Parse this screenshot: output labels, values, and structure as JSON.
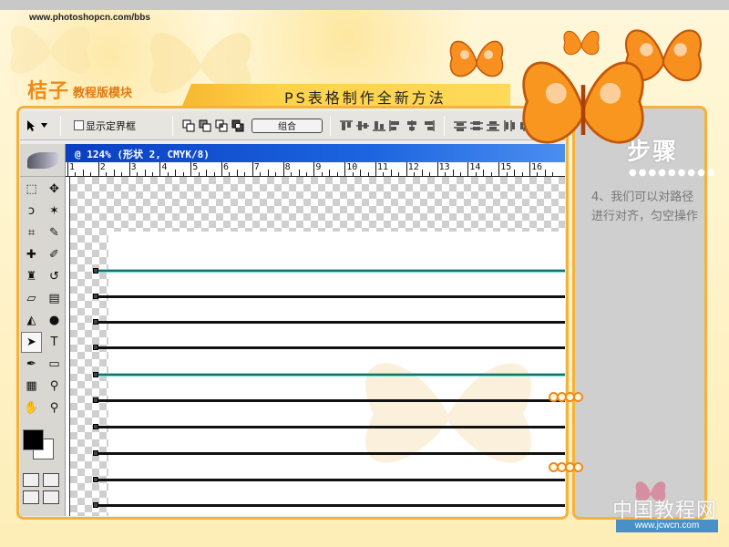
{
  "site": {
    "url": "www.photoshopcn.com/bbs"
  },
  "brand": {
    "main": "桔子",
    "sub": "教程版模块"
  },
  "page_title": "PS表格制作全新方法",
  "options_bar": {
    "show_bounding_box_label": "显示定界框",
    "combine_label": "组合"
  },
  "document": {
    "title": "@ 124% (形状 2, CMYK/8)",
    "ruler_labels": [
      "1",
      "2",
      "3",
      "4",
      "5",
      "6",
      "7",
      "8",
      "9",
      "10",
      "11",
      "12",
      "13",
      "14",
      "15",
      "16"
    ]
  },
  "steps": {
    "title": "步骤",
    "dots": "●●●●●●●●●",
    "text": "4、我们可以对路径进行对齐，匀空操作"
  },
  "watermark": {
    "text": "中国教程网",
    "url": "www.jcwcn.com"
  },
  "colors": {
    "accent_orange": "#f4b23a",
    "title_bar_blue": "#0a3fbf",
    "selected_path": "#1d6f6a"
  }
}
